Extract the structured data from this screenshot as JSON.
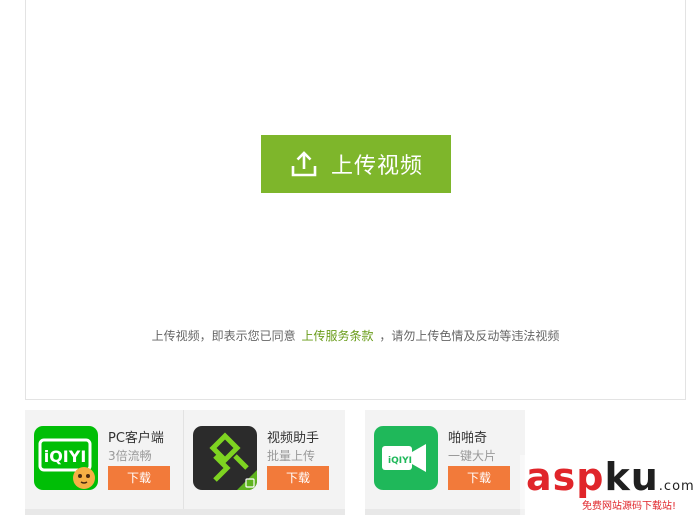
{
  "upload": {
    "button_label": "上传视频",
    "terms_prefix": "上传视频，即表示您已同意",
    "terms_link": "上传服务条款",
    "terms_suffix": "，请勿上传色情及反动等违法视频"
  },
  "apps": [
    {
      "name": "PC客户端",
      "subtitle": "3倍流畅",
      "download_label": "下载",
      "icon_text": "iQIYI",
      "icon_color": "#00be06"
    },
    {
      "name": "视频助手",
      "subtitle": "批量上传",
      "download_label": "下载",
      "icon_color": "#2b2b2b"
    },
    {
      "name": "啪啪奇",
      "subtitle": "一键大片",
      "download_label": "下载",
      "icon_text": "iQIYI",
      "icon_color": "#1fb85a"
    }
  ],
  "watermark": {
    "logo_a": "asp",
    "logo_b": "ku",
    "logo_c": ".com",
    "slogan": "免费网站源码下载站!"
  },
  "colors": {
    "accent_green": "#7eb62b",
    "download_orange": "#f27a3a",
    "link_green": "#699c1a"
  }
}
